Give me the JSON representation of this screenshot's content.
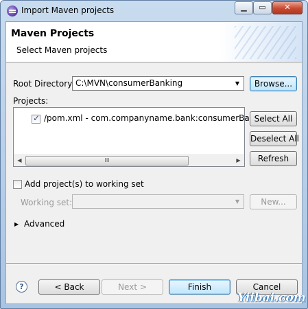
{
  "window": {
    "title": "Import Maven projects",
    "minimize_glyph": "▁",
    "maximize_glyph": "▭",
    "close_glyph": "✕"
  },
  "header": {
    "title": "Maven Projects",
    "description": "Select Maven projects"
  },
  "root_directory": {
    "label": "Root Directory:",
    "value": "C:\\MVN\\consumerBanking",
    "browse_label": "Browse..."
  },
  "projects": {
    "label": "Projects:",
    "items": [
      {
        "label": "/pom.xml - com.companyname.bank:consumerBankin",
        "checked": true
      }
    ],
    "select_all_label": "Select All",
    "deselect_all_label": "Deselect All",
    "refresh_label": "Refresh",
    "scroll_left_glyph": "◀",
    "scroll_right_glyph": "▶",
    "thumb_grip": "III"
  },
  "working_set": {
    "add_label": "Add project(s) to working set",
    "checked": false,
    "working_set_label": "Working set:",
    "working_set_value": "",
    "new_label": "New..."
  },
  "advanced": {
    "label": "Advanced",
    "expander_glyph": "▶"
  },
  "footer": {
    "help_glyph": "?",
    "back_label": "< Back",
    "next_label": "Next >",
    "finish_label": "Finish",
    "cancel_label": "Cancel"
  },
  "watermark": "Yiibai.com"
}
